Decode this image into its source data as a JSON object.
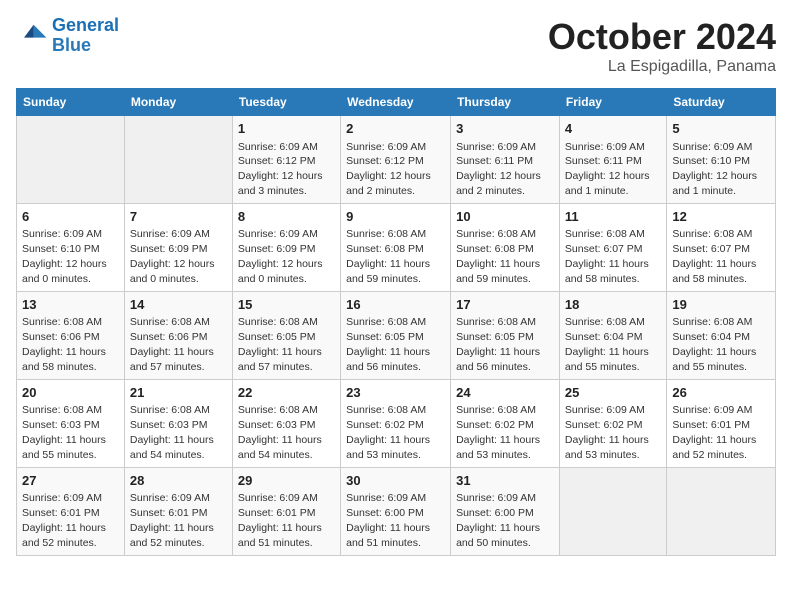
{
  "header": {
    "logo_line1": "General",
    "logo_line2": "Blue",
    "month": "October 2024",
    "location": "La Espigadilla, Panama"
  },
  "weekdays": [
    "Sunday",
    "Monday",
    "Tuesday",
    "Wednesday",
    "Thursday",
    "Friday",
    "Saturday"
  ],
  "weeks": [
    [
      {
        "day": "",
        "empty": true
      },
      {
        "day": "",
        "empty": true
      },
      {
        "day": "1",
        "sunrise": "6:09 AM",
        "sunset": "6:12 PM",
        "daylight": "12 hours and 3 minutes."
      },
      {
        "day": "2",
        "sunrise": "6:09 AM",
        "sunset": "6:12 PM",
        "daylight": "12 hours and 2 minutes."
      },
      {
        "day": "3",
        "sunrise": "6:09 AM",
        "sunset": "6:11 PM",
        "daylight": "12 hours and 2 minutes."
      },
      {
        "day": "4",
        "sunrise": "6:09 AM",
        "sunset": "6:11 PM",
        "daylight": "12 hours and 1 minute."
      },
      {
        "day": "5",
        "sunrise": "6:09 AM",
        "sunset": "6:10 PM",
        "daylight": "12 hours and 1 minute."
      }
    ],
    [
      {
        "day": "6",
        "sunrise": "6:09 AM",
        "sunset": "6:10 PM",
        "daylight": "12 hours and 0 minutes."
      },
      {
        "day": "7",
        "sunrise": "6:09 AM",
        "sunset": "6:09 PM",
        "daylight": "12 hours and 0 minutes."
      },
      {
        "day": "8",
        "sunrise": "6:09 AM",
        "sunset": "6:09 PM",
        "daylight": "12 hours and 0 minutes."
      },
      {
        "day": "9",
        "sunrise": "6:08 AM",
        "sunset": "6:08 PM",
        "daylight": "11 hours and 59 minutes."
      },
      {
        "day": "10",
        "sunrise": "6:08 AM",
        "sunset": "6:08 PM",
        "daylight": "11 hours and 59 minutes."
      },
      {
        "day": "11",
        "sunrise": "6:08 AM",
        "sunset": "6:07 PM",
        "daylight": "11 hours and 58 minutes."
      },
      {
        "day": "12",
        "sunrise": "6:08 AM",
        "sunset": "6:07 PM",
        "daylight": "11 hours and 58 minutes."
      }
    ],
    [
      {
        "day": "13",
        "sunrise": "6:08 AM",
        "sunset": "6:06 PM",
        "daylight": "11 hours and 58 minutes."
      },
      {
        "day": "14",
        "sunrise": "6:08 AM",
        "sunset": "6:06 PM",
        "daylight": "11 hours and 57 minutes."
      },
      {
        "day": "15",
        "sunrise": "6:08 AM",
        "sunset": "6:05 PM",
        "daylight": "11 hours and 57 minutes."
      },
      {
        "day": "16",
        "sunrise": "6:08 AM",
        "sunset": "6:05 PM",
        "daylight": "11 hours and 56 minutes."
      },
      {
        "day": "17",
        "sunrise": "6:08 AM",
        "sunset": "6:05 PM",
        "daylight": "11 hours and 56 minutes."
      },
      {
        "day": "18",
        "sunrise": "6:08 AM",
        "sunset": "6:04 PM",
        "daylight": "11 hours and 55 minutes."
      },
      {
        "day": "19",
        "sunrise": "6:08 AM",
        "sunset": "6:04 PM",
        "daylight": "11 hours and 55 minutes."
      }
    ],
    [
      {
        "day": "20",
        "sunrise": "6:08 AM",
        "sunset": "6:03 PM",
        "daylight": "11 hours and 55 minutes."
      },
      {
        "day": "21",
        "sunrise": "6:08 AM",
        "sunset": "6:03 PM",
        "daylight": "11 hours and 54 minutes."
      },
      {
        "day": "22",
        "sunrise": "6:08 AM",
        "sunset": "6:03 PM",
        "daylight": "11 hours and 54 minutes."
      },
      {
        "day": "23",
        "sunrise": "6:08 AM",
        "sunset": "6:02 PM",
        "daylight": "11 hours and 53 minutes."
      },
      {
        "day": "24",
        "sunrise": "6:08 AM",
        "sunset": "6:02 PM",
        "daylight": "11 hours and 53 minutes."
      },
      {
        "day": "25",
        "sunrise": "6:09 AM",
        "sunset": "6:02 PM",
        "daylight": "11 hours and 53 minutes."
      },
      {
        "day": "26",
        "sunrise": "6:09 AM",
        "sunset": "6:01 PM",
        "daylight": "11 hours and 52 minutes."
      }
    ],
    [
      {
        "day": "27",
        "sunrise": "6:09 AM",
        "sunset": "6:01 PM",
        "daylight": "11 hours and 52 minutes."
      },
      {
        "day": "28",
        "sunrise": "6:09 AM",
        "sunset": "6:01 PM",
        "daylight": "11 hours and 52 minutes."
      },
      {
        "day": "29",
        "sunrise": "6:09 AM",
        "sunset": "6:01 PM",
        "daylight": "11 hours and 51 minutes."
      },
      {
        "day": "30",
        "sunrise": "6:09 AM",
        "sunset": "6:00 PM",
        "daylight": "11 hours and 51 minutes."
      },
      {
        "day": "31",
        "sunrise": "6:09 AM",
        "sunset": "6:00 PM",
        "daylight": "11 hours and 50 minutes."
      },
      {
        "day": "",
        "empty": true
      },
      {
        "day": "",
        "empty": true
      }
    ]
  ]
}
